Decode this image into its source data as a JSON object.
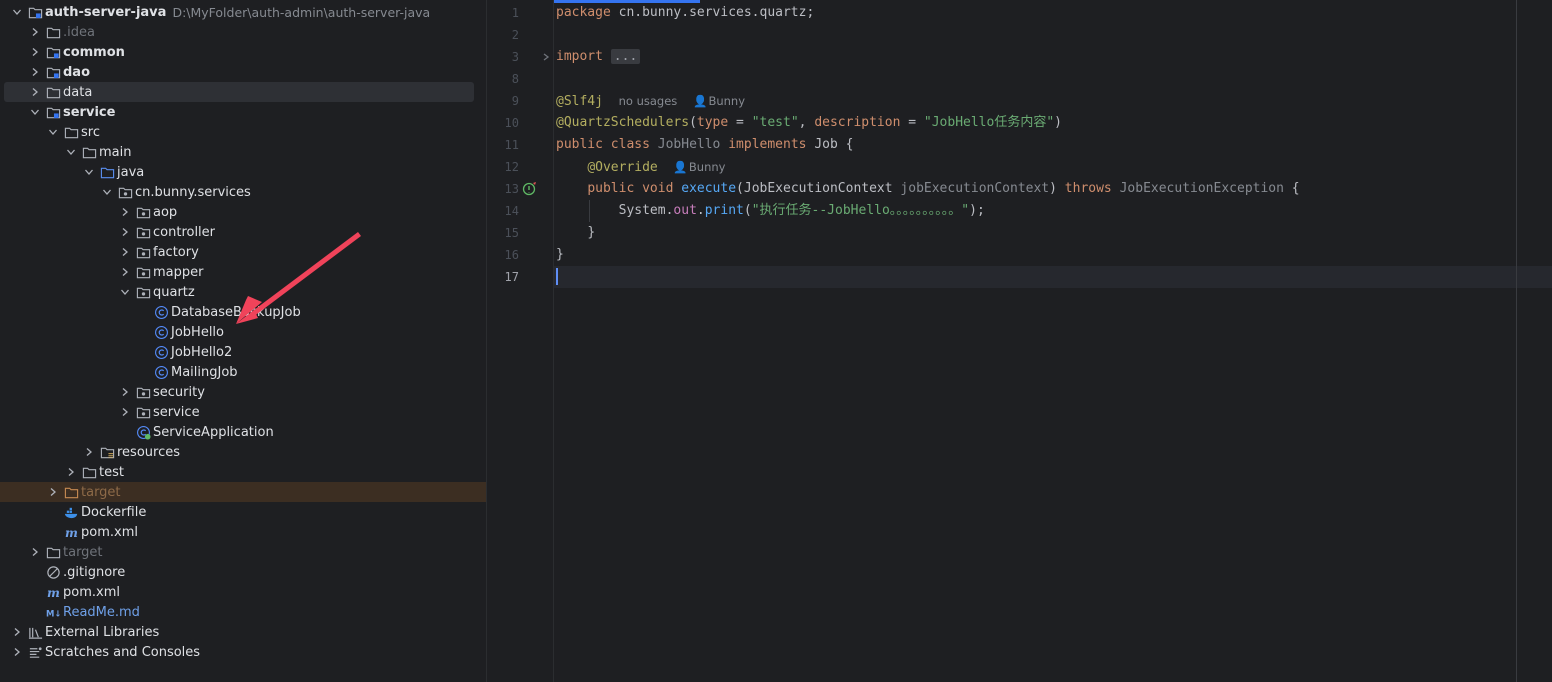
{
  "tree": {
    "rows": [
      {
        "label": "auth-server-java",
        "path": "D:\\MyFolder\\auth-admin\\auth-server-java",
        "icon": "module-folder-icon",
        "chevron": "down",
        "style": "bold",
        "depth": 0
      },
      {
        "label": ".idea",
        "icon": "folder-icon",
        "chevron": "right",
        "style": "muted",
        "depth": 1
      },
      {
        "label": "common",
        "icon": "module-folder-icon",
        "chevron": "right",
        "style": "bold",
        "depth": 1
      },
      {
        "label": "dao",
        "icon": "module-folder-icon",
        "chevron": "right",
        "style": "bold",
        "depth": 1
      },
      {
        "label": "data",
        "icon": "folder-icon",
        "chevron": "right",
        "style": "normal",
        "depth": 1,
        "selected": true
      },
      {
        "label": "service",
        "icon": "module-folder-icon",
        "chevron": "down",
        "style": "bold",
        "depth": 1
      },
      {
        "label": "src",
        "icon": "folder-icon",
        "chevron": "down",
        "style": "normal",
        "depth": 2
      },
      {
        "label": "main",
        "icon": "folder-icon",
        "chevron": "down",
        "style": "normal",
        "depth": 3
      },
      {
        "label": "java",
        "icon": "source-folder-icon",
        "chevron": "down",
        "style": "normal",
        "depth": 4
      },
      {
        "label": "cn.bunny.services",
        "icon": "package-icon",
        "chevron": "down",
        "style": "normal",
        "depth": 5
      },
      {
        "label": "aop",
        "icon": "package-icon",
        "chevron": "right",
        "style": "normal",
        "depth": 6
      },
      {
        "label": "controller",
        "icon": "package-icon",
        "chevron": "right",
        "style": "normal",
        "depth": 6
      },
      {
        "label": "factory",
        "icon": "package-icon",
        "chevron": "right",
        "style": "normal",
        "depth": 6
      },
      {
        "label": "mapper",
        "icon": "package-icon",
        "chevron": "right",
        "style": "normal",
        "depth": 6
      },
      {
        "label": "quartz",
        "icon": "package-icon",
        "chevron": "down",
        "style": "normal",
        "depth": 6
      },
      {
        "label": "DatabaseBackupJob",
        "icon": "class-icon",
        "chevron": "none",
        "style": "normal",
        "depth": 7
      },
      {
        "label": "JobHello",
        "icon": "class-icon",
        "chevron": "none",
        "style": "normal",
        "depth": 7
      },
      {
        "label": "JobHello2",
        "icon": "class-icon",
        "chevron": "none",
        "style": "normal",
        "depth": 7
      },
      {
        "label": "MailingJob",
        "icon": "class-icon",
        "chevron": "none",
        "style": "normal",
        "depth": 7
      },
      {
        "label": "security",
        "icon": "package-icon",
        "chevron": "right",
        "style": "normal",
        "depth": 6
      },
      {
        "label": "service",
        "icon": "package-icon",
        "chevron": "right",
        "style": "normal",
        "depth": 6
      },
      {
        "label": "ServiceApplication",
        "icon": "spring-class-icon",
        "chevron": "none",
        "style": "normal",
        "depth": 6
      },
      {
        "label": "resources",
        "icon": "resources-folder-icon",
        "chevron": "right",
        "style": "normal",
        "depth": 4
      },
      {
        "label": "test",
        "icon": "folder-icon",
        "chevron": "right",
        "style": "normal",
        "depth": 3
      },
      {
        "label": "target",
        "icon": "excluded-folder-icon",
        "chevron": "right",
        "style": "target",
        "depth": 2,
        "excluded": true
      },
      {
        "label": "Dockerfile",
        "icon": "docker-icon",
        "chevron": "none",
        "style": "normal",
        "depth": 2
      },
      {
        "label": "pom.xml",
        "icon": "maven-icon",
        "chevron": "none",
        "style": "normal",
        "depth": 2
      },
      {
        "label": "target",
        "icon": "folder-icon",
        "chevron": "right",
        "style": "muted",
        "depth": 1
      },
      {
        "label": ".gitignore",
        "icon": "gitignore-icon",
        "chevron": "none",
        "style": "normal",
        "depth": 1
      },
      {
        "label": "pom.xml",
        "icon": "maven-icon",
        "chevron": "none",
        "style": "normal",
        "depth": 1
      },
      {
        "label": "ReadMe.md",
        "icon": "markdown-icon",
        "chevron": "none",
        "style": "blue",
        "depth": 1
      },
      {
        "label": "External Libraries",
        "icon": "libraries-icon",
        "chevron": "right",
        "style": "normal",
        "depth": 0
      },
      {
        "label": "Scratches and Consoles",
        "icon": "scratches-icon",
        "chevron": "right",
        "style": "normal",
        "depth": 0
      }
    ]
  },
  "editor": {
    "line_numbers": [
      "1",
      "2",
      "3",
      "8",
      "9",
      "10",
      "11",
      "12",
      "13",
      "14",
      "15",
      "16",
      "17"
    ],
    "current_line": "17",
    "code": {
      "l1_kw": "package",
      "l1_rest": " cn.bunny.services.quartz;",
      "l3_kw": "import",
      "l3_fold": "...",
      "l9_an": "@Slf4j",
      "l9_usages": "no usages",
      "l9_author": "Bunny",
      "l10_an": "@QuartzSchedulers",
      "l10_p1": "(",
      "l10_type": "type",
      "l10_eq1": " = ",
      "l10_val1": "\"test\"",
      "l10_comma": ", ",
      "l10_desc": "description",
      "l10_eq2": " = ",
      "l10_val2": "\"JobHello任务内容\"",
      "l10_p2": ")",
      "l11_kw1": "public",
      "l11_kw2": "class",
      "l11_name": "JobHello",
      "l11_kw3": "implements",
      "l11_iface": "Job",
      "l11_brace": " {",
      "l12_an": "@Override",
      "l12_author": "Bunny",
      "l13_kw1": "public",
      "l13_kw2": "void",
      "l13_fn": "execute",
      "l13_p1": "(",
      "l13_ptype": "JobExecutionContext",
      "l13_pname": "jobExecutionContext",
      "l13_p2": ")",
      "l13_throws": "throws",
      "l13_exc": "JobExecutionException",
      "l13_brace": " {",
      "l14_sys": "System.",
      "l14_out": "out",
      "l14_dot": ".",
      "l14_fn": "print",
      "l14_p1": "(",
      "l14_str": "\"执行任务--JobHello。。。。。。。。。。\"",
      "l14_p2": ");",
      "l15": "}",
      "l16": "}"
    }
  },
  "colors": {
    "background": "#1e1f22",
    "selection": "#2e3035",
    "excluded": "#3c2e22",
    "arrow": "#f0435a",
    "accent": "#3574f0"
  }
}
